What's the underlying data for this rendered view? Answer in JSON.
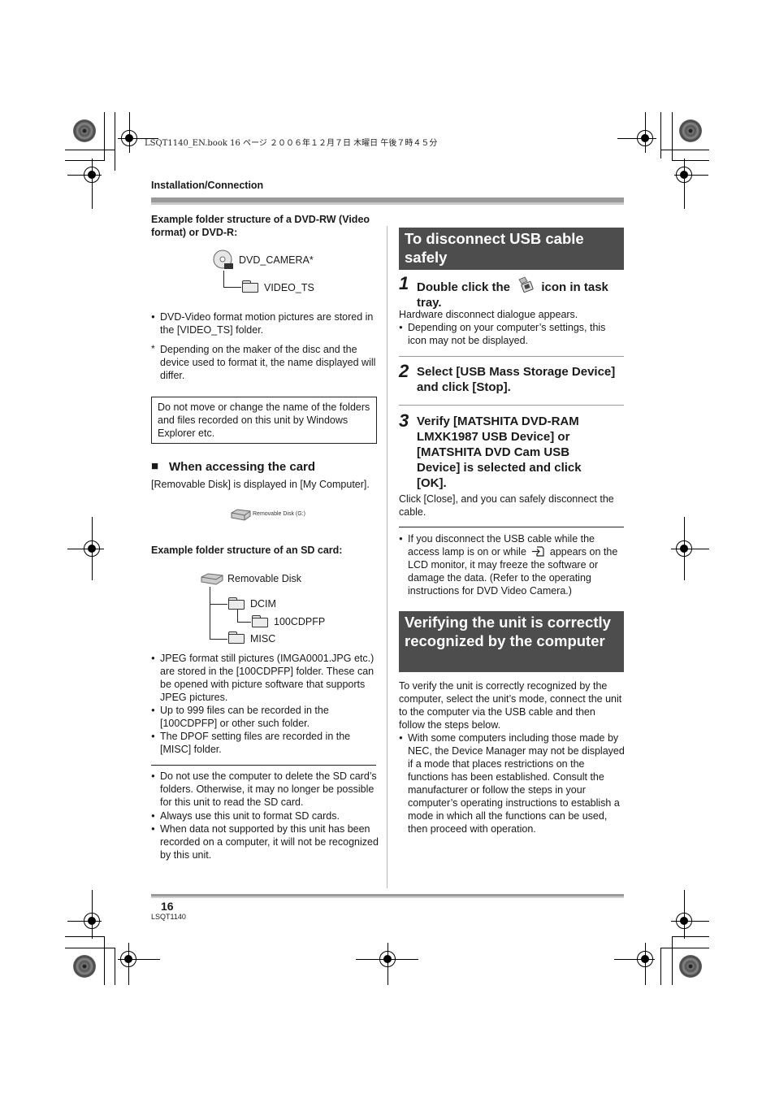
{
  "print_header": "LSQT1140_EN.book  16 ページ  ２００６年１２月７日  木曜日  午後７時４５分",
  "section_label": "Installation/Connection",
  "left": {
    "dvd_heading": "Example folder structure of a DVD-RW (Video format) or DVD-R:",
    "dvd_tree": {
      "root": "DVD_CAMERA*",
      "child": "VIDEO_TS"
    },
    "dvd_bullet": "DVD-Video format motion pictures are stored in the [VIDEO_TS] folder.",
    "dvd_footnote_mark": "*",
    "dvd_footnote": "Depending on the maker of the disc and the device used to format it, the name displayed will differ.",
    "note_box": "Do not move or change the name of the folders and files recorded on this unit by Windows Explorer etc.",
    "card_heading_marker": "■",
    "card_heading": "When accessing the card",
    "card_text": "[Removable Disk] is displayed in [My Computer].",
    "drive_icon_label": "Removable Disk (G:)",
    "sd_heading": "Example folder structure of an SD card:",
    "sd_tree": {
      "root": "Removable Disk",
      "dcim": "DCIM",
      "sub": "100CDPFP",
      "misc": "MISC"
    },
    "sd_bullets": [
      "JPEG format still pictures (IMGA0001.JPG etc.) are stored in the [100CDPFP] folder. These can be opened with picture software that supports JPEG pictures.",
      "Up to 999 files can be recorded in the [100CDPFP] or other such folder.",
      "The DPOF setting files are recorded in the [MISC] folder."
    ],
    "caution_bullets": [
      "Do not use the computer to delete the SD card’s folders. Otherwise, it may no longer be possible for this unit to read the SD card.",
      "Always use this unit to format SD cards.",
      "When data not supported by this unit has been recorded on a computer, it will not be recognized by this unit."
    ]
  },
  "right": {
    "usb_title": "To disconnect USB cable safely",
    "steps": [
      {
        "num": "1",
        "text_before": "Double click the",
        "text_after": "icon in task tray.",
        "body": "Hardware disconnect dialogue appears.",
        "bullet": "Depending on your computer’s settings, this icon may not be displayed."
      },
      {
        "num": "2",
        "text": "Select [USB Mass Storage Device] and click [Stop]."
      },
      {
        "num": "3",
        "text": "Verify [MATSHITA DVD-RAM LMXK1987 USB Device] or [MATSHITA DVD Cam USB Device] is selected and click [OK].",
        "body": "Click [Close], and you can safely disconnect the cable."
      }
    ],
    "warning_before": "If you disconnect the USB cable while the access lamp is on or while",
    "warning_after": "appears on the LCD monitor, it may freeze the software or damage the data. (Refer to the operating instructions for DVD Video Camera.)",
    "verify_title": "Verifying the unit is correctly recognized by the computer",
    "verify_text": "To verify the unit is correctly recognized by the computer, select the unit’s mode, connect the unit to the computer via the USB cable and then follow the steps below.",
    "verify_bullet": "With some computers including those made by NEC, the Device Manager may not be displayed if a mode that places restrictions on the functions has been established. Consult the manufacturer or follow the steps in your computer’s operating instructions to establish a mode in which all the functions can be used, then proceed with operation."
  },
  "footer": {
    "page_number": "16",
    "doc_code": "LSQT1140"
  },
  "colors": {
    "heading_bar": "#4d4d4d",
    "rule_bar": "#999999"
  }
}
